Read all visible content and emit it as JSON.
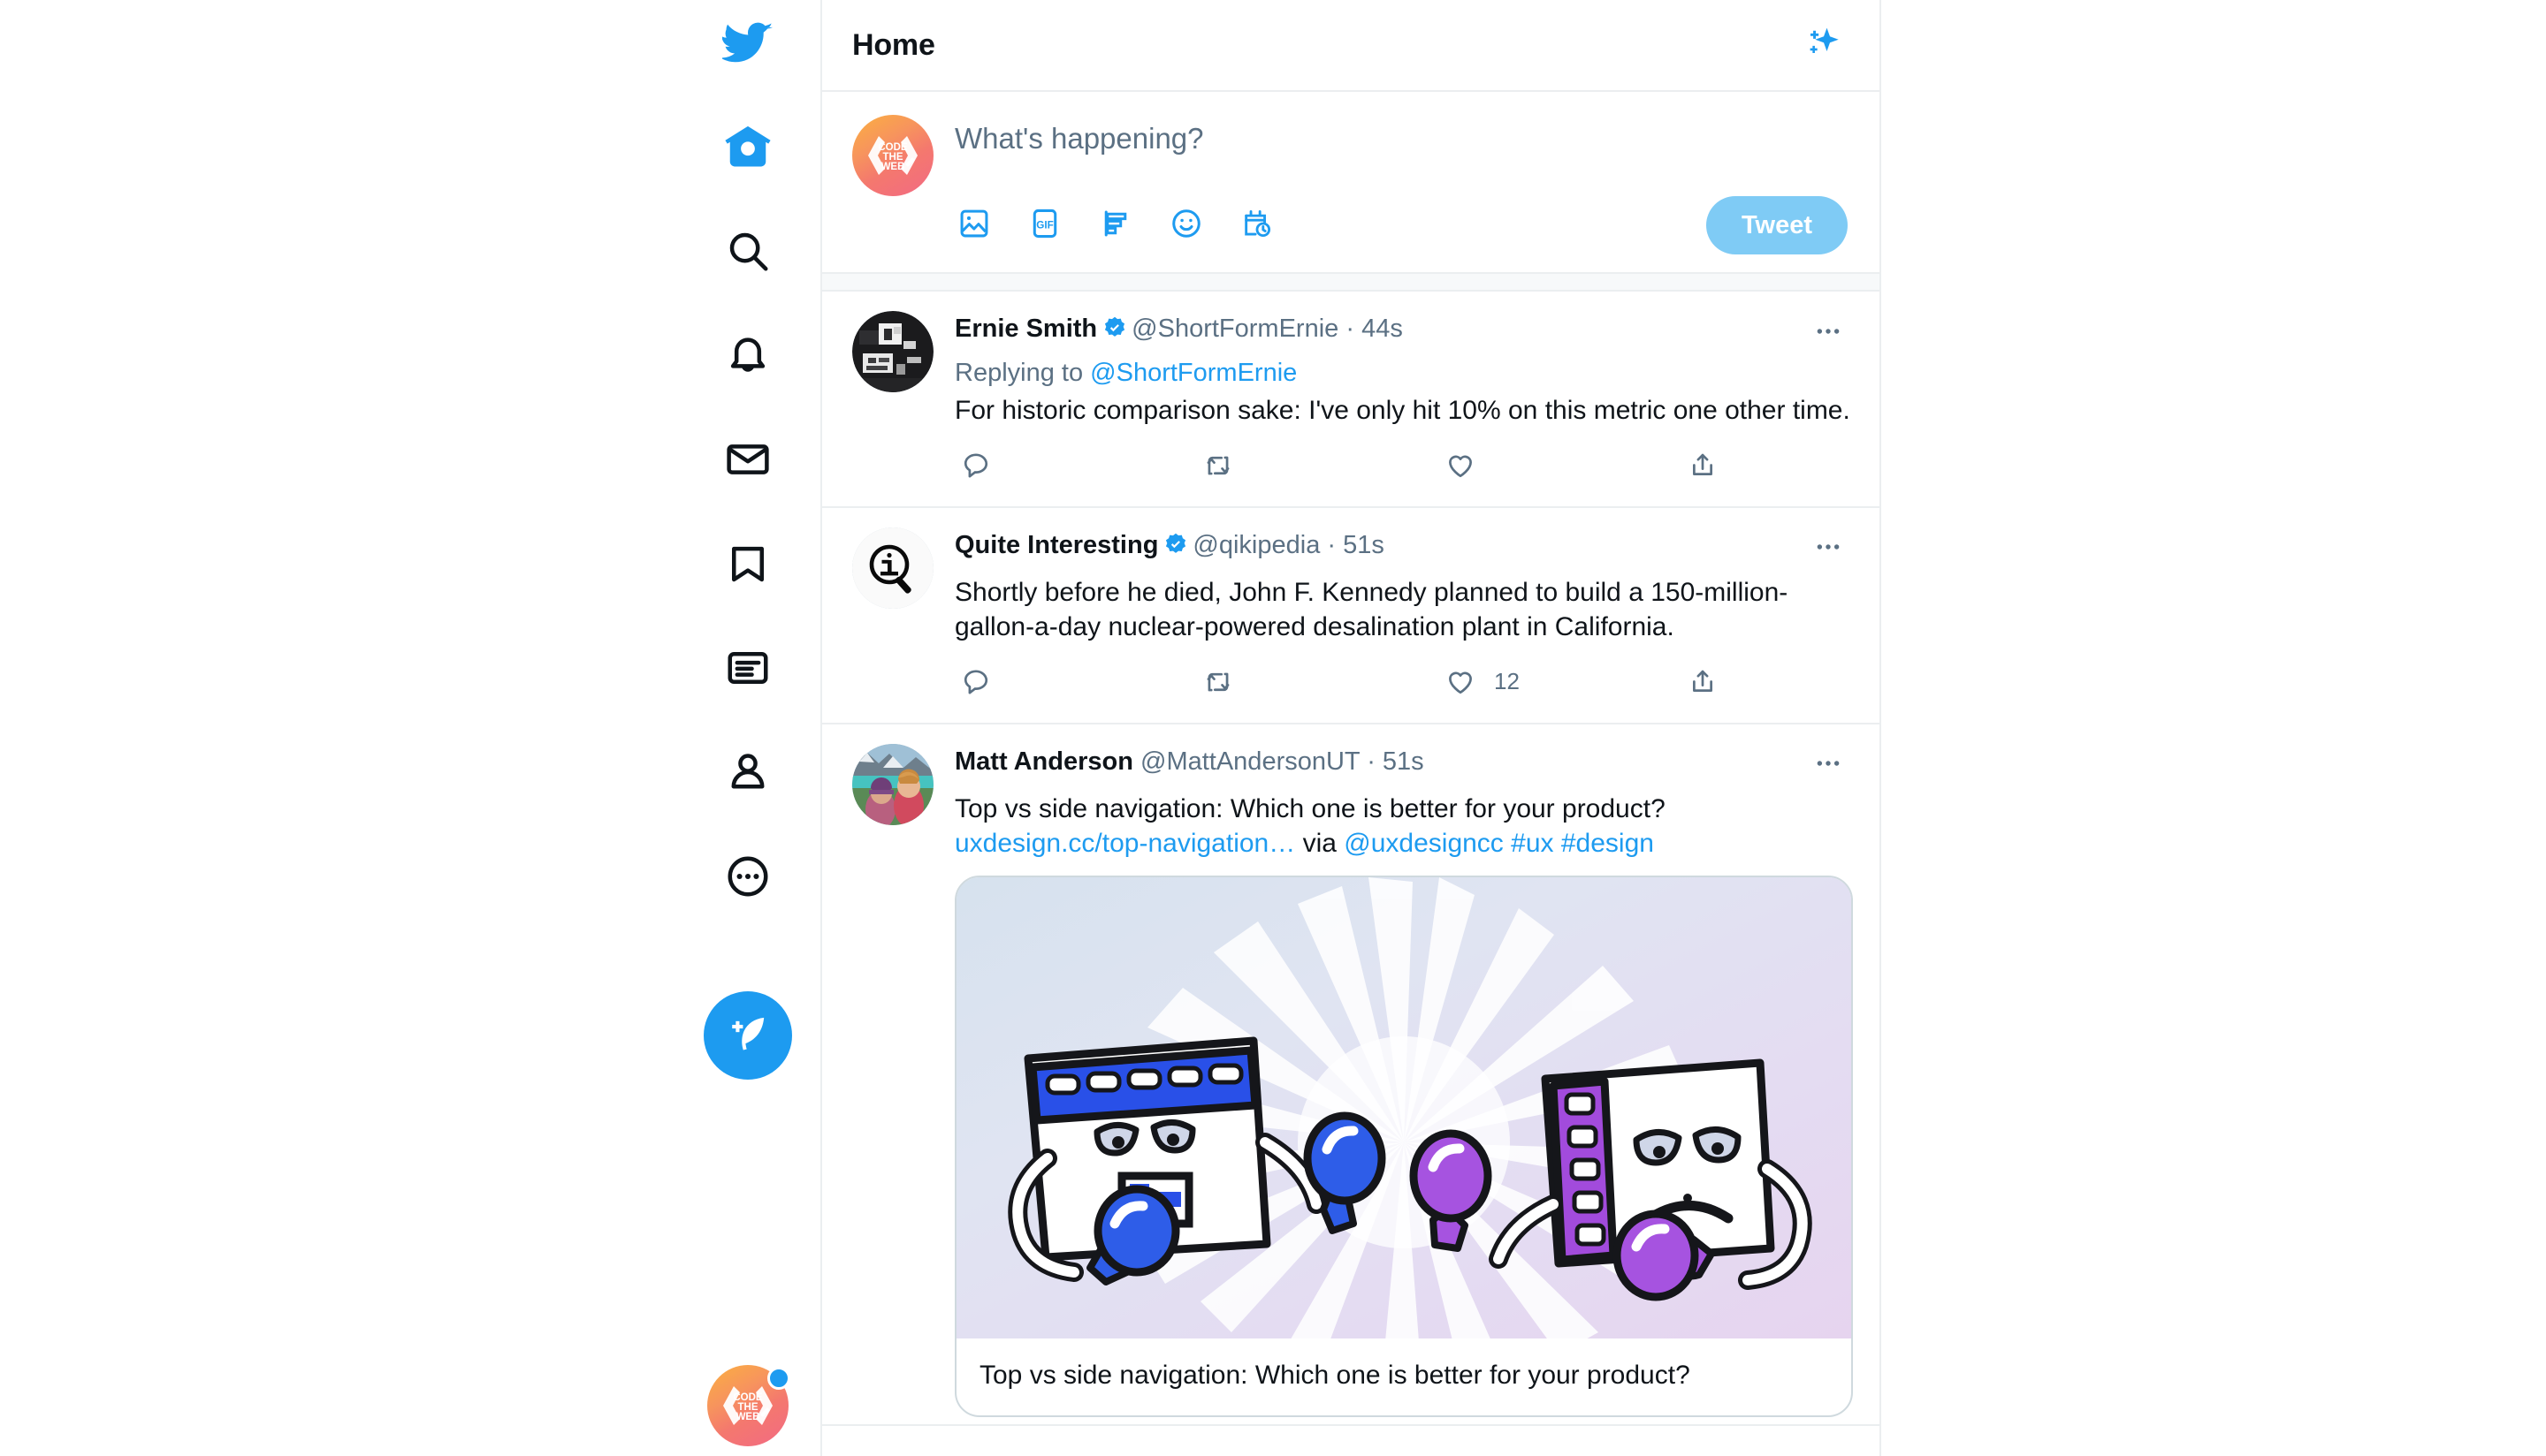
{
  "app": {
    "name": "Twitter",
    "brand_color": "#1d9bf0",
    "border_color": "#ebeef0",
    "muted_color": "#5b7083"
  },
  "sidebar": {
    "logo_icon": "twitter-bird-icon",
    "items": [
      {
        "id": "home",
        "icon": "home-icon",
        "label": "Home",
        "active": true
      },
      {
        "id": "explore",
        "icon": "search-icon",
        "label": "Explore",
        "active": false
      },
      {
        "id": "notifications",
        "icon": "bell-icon",
        "label": "Notifications",
        "active": false
      },
      {
        "id": "messages",
        "icon": "mail-icon",
        "label": "Messages",
        "active": false
      },
      {
        "id": "bookmarks",
        "icon": "bookmark-icon",
        "label": "Bookmarks",
        "active": false
      },
      {
        "id": "lists",
        "icon": "list-icon",
        "label": "Lists",
        "active": false
      },
      {
        "id": "profile",
        "icon": "person-icon",
        "label": "Profile",
        "active": false
      },
      {
        "id": "more",
        "icon": "more-circle-icon",
        "label": "More",
        "active": false
      }
    ],
    "compose_fab": {
      "icon": "compose-feather-icon",
      "label": "Tweet"
    },
    "account_avatar": {
      "logo_lines": [
        "CODE",
        "THE",
        "WEB"
      ],
      "has_notification_dot": true
    }
  },
  "header": {
    "title": "Home",
    "sparkle_icon": "sparkle-icon"
  },
  "compose": {
    "avatar": {
      "logo_lines": [
        "CODE",
        "THE",
        "WEB"
      ]
    },
    "placeholder": "What's happening?",
    "icons": [
      {
        "id": "media",
        "icon": "image-icon"
      },
      {
        "id": "gif",
        "icon": "gif-icon",
        "label": "GIF"
      },
      {
        "id": "poll",
        "icon": "poll-icon"
      },
      {
        "id": "emoji",
        "icon": "emoji-icon"
      },
      {
        "id": "schedule",
        "icon": "schedule-icon"
      }
    ],
    "tweet_button": "Tweet"
  },
  "timeline": [
    {
      "id": "tweet-ernie-smith",
      "avatar": "photo-bw",
      "name": "Ernie Smith",
      "verified": true,
      "handle": "@ShortFormErnie",
      "separator": "·",
      "time": "44s",
      "replying_prefix": "Replying to ",
      "replying_to": "@ShortFormErnie",
      "text": "For historic comparison sake: I've only hit 10% on this metric one other time.",
      "actions": {
        "reply": "",
        "retweet": "",
        "like": "",
        "share": ""
      },
      "more_icon": "more-horizontal-icon"
    },
    {
      "id": "tweet-quite-interesting",
      "avatar": "magnifier-info",
      "name": "Quite Interesting",
      "verified": true,
      "handle": "@qikipedia",
      "separator": "·",
      "time": "51s",
      "text": "Shortly before he died, John F. Kennedy planned to build a 150-million-gallon-a-day nuclear-powered desalination plant in California.",
      "actions": {
        "reply": "",
        "retweet": "",
        "like": "12",
        "share": ""
      },
      "more_icon": "more-horizontal-icon"
    },
    {
      "id": "tweet-matt-anderson",
      "avatar": "photo-couple",
      "name": "Matt Anderson",
      "verified": false,
      "handle": "@MattAndersonUT",
      "separator": "·",
      "time": "51s",
      "text_parts": [
        {
          "type": "text",
          "value": "Top vs side navigation: Which one is better for your product? "
        },
        {
          "type": "link",
          "value": "uxdesign.cc/top-navigation…"
        },
        {
          "type": "text",
          "value": " via "
        },
        {
          "type": "link",
          "value": "@uxdesigncc"
        },
        {
          "type": "text",
          "value": " "
        },
        {
          "type": "link",
          "value": "#ux"
        },
        {
          "type": "text",
          "value": " "
        },
        {
          "type": "link",
          "value": "#design"
        }
      ],
      "card": {
        "image_alt": "two-browser-windows-boxing-illustration",
        "title": "Top vs side navigation: Which one is better for your product?"
      },
      "more_icon": "more-horizontal-icon"
    }
  ]
}
